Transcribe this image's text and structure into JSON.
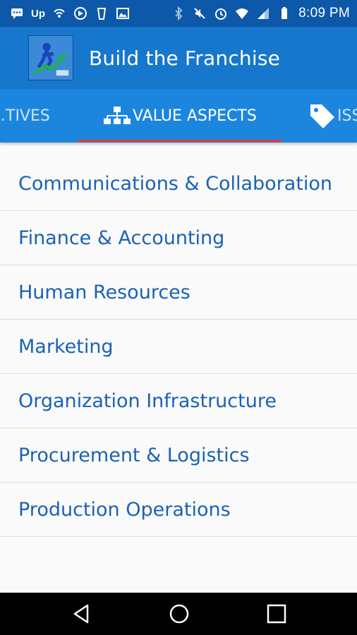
{
  "status_bar": {
    "time": "8:09 PM",
    "carrier_text": "Up",
    "icons": [
      "messages-icon",
      "up-icon",
      "hotspot-icon",
      "speed-icon",
      "cup-icon",
      "image-icon",
      "bluetooth-icon",
      "mute-icon",
      "alarm-icon",
      "wifi-icon",
      "signal-icon",
      "battery-icon"
    ]
  },
  "app_bar": {
    "title": "Build the Franchise",
    "logo": "app-logo"
  },
  "tabs": [
    {
      "label": "…TIVES",
      "icon": null
    },
    {
      "label": "VALUE ASPECTS",
      "icon": "org-chart-icon",
      "selected": true
    },
    {
      "label": "ISS",
      "icon": "tag-icon"
    }
  ],
  "colors": {
    "status_bar": "#0d58a8",
    "app_bar": "#1677cc",
    "tab_bar": "#1c86de",
    "indicator": "#e53935",
    "list_text": "#1b62b4"
  },
  "list": {
    "items": [
      "Communications & Collaboration",
      "Finance & Accounting",
      "Human Resources",
      "Marketing",
      "Organization Infrastructure",
      "Procurement & Logistics",
      "Production Operations"
    ]
  },
  "nav_bar": {
    "buttons": [
      "back-icon",
      "home-icon",
      "recent-apps-icon"
    ]
  }
}
